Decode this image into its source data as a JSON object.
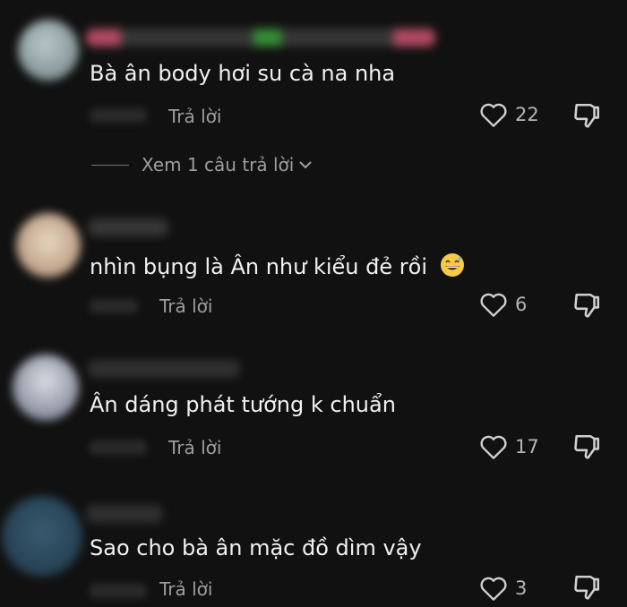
{
  "reply_label": "Trả lời",
  "comments": [
    {
      "text": "Bà ân body hơi su cà na nha",
      "likes": "22"
    },
    {
      "text": "nhìn bụng là Ân như kiểu đẻ rồi",
      "emoji": "sweat-smile-emoji",
      "likes": "6"
    },
    {
      "text": "Ân dáng phát tướng k chuẩn",
      "likes": "17"
    },
    {
      "text": "Sao cho bà ân mặc đồ dìm vậy",
      "likes": "3"
    }
  ],
  "view_replies": {
    "label": "Xem 1 câu trả lời",
    "icon": "chevron-down-icon"
  },
  "icons": {
    "like": "heart-outline-icon",
    "dislike": "thumbs-down-icon"
  },
  "colors": {
    "background": "#111111",
    "text": "#f1f1f1",
    "muted": "#9e9e9e"
  }
}
